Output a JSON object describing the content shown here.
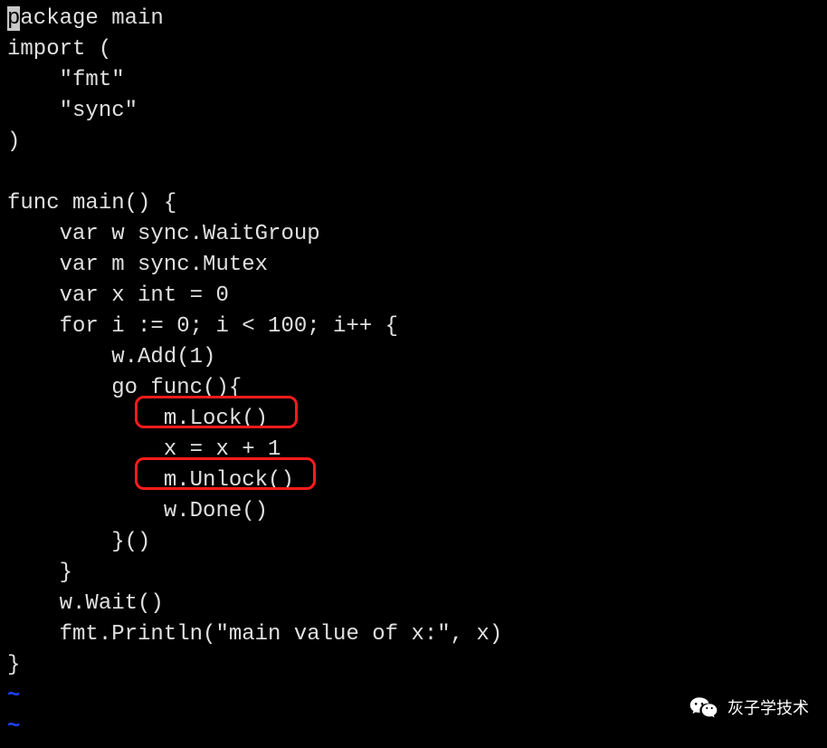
{
  "code": {
    "line1_cursor": "p",
    "line1_rest": "ackage main",
    "line2": "import (",
    "line3": "    \"fmt\"",
    "line4": "    \"sync\"",
    "line5": ")",
    "line6": "",
    "line7": "func main() {",
    "line8": "    var w sync.WaitGroup",
    "line9": "    var m sync.Mutex",
    "line10": "    var x int = 0",
    "line11": "    for i := 0; i < 100; i++ {",
    "line12": "        w.Add(1)",
    "line13": "        go func(){",
    "line14": "            m.Lock()",
    "line15": "            x = x + 1",
    "line16": "            m.Unlock()",
    "line17": "            w.Done()",
    "line18": "        }()",
    "line19": "    }",
    "line20": "    w.Wait()",
    "line21": "    fmt.Println(\"main value of x:\", x)",
    "line22": "}",
    "tilde1": "~",
    "tilde2": "~"
  },
  "watermark": {
    "text": "灰子学技术"
  },
  "highlights": [
    {
      "label": "m.Lock() highlight"
    },
    {
      "label": "m.Unlock() highlight"
    }
  ]
}
